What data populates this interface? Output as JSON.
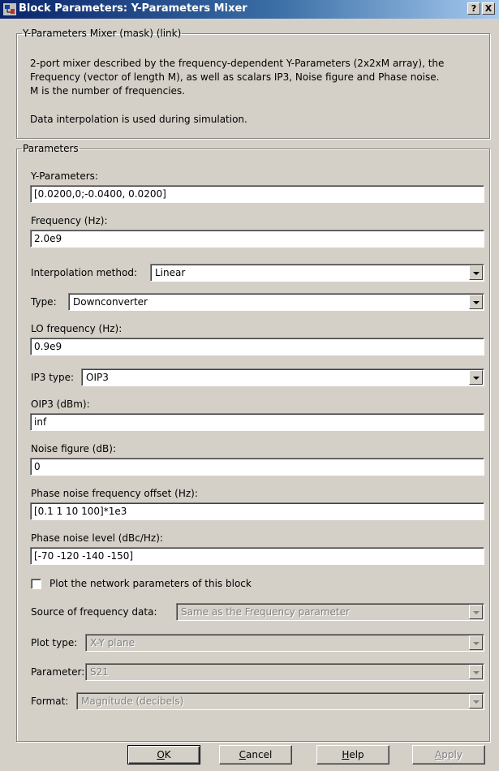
{
  "window": {
    "title": "Block Parameters: Y-Parameters Mixer",
    "help_glyph": "?",
    "close_glyph": "X",
    "icon": "simulink-block-icon"
  },
  "description": {
    "group_title": "Y-Parameters Mixer (mask) (link)",
    "line1": "2-port mixer described by the frequency-dependent Y-Parameters (2x2xM array), the",
    "line2": "Frequency (vector of length M), as well as scalars IP3, Noise figure and Phase noise.",
    "line3": "M is the number of frequencies.",
    "line4": "Data interpolation is used during simulation."
  },
  "parameters": {
    "group_title": "Parameters",
    "y_parameters": {
      "label": "Y-Parameters:",
      "value": "[0.0200,0;-0.0400, 0.0200]"
    },
    "frequency": {
      "label": "Frequency (Hz):",
      "value": "2.0e9"
    },
    "interpolation": {
      "label": "Interpolation method:",
      "value": "Linear"
    },
    "type": {
      "label": "Type:",
      "value": "Downconverter"
    },
    "lo_frequency": {
      "label": "LO frequency (Hz):",
      "value": "0.9e9"
    },
    "ip3_type": {
      "label": "IP3 type:",
      "value": "OIP3"
    },
    "oip3": {
      "label": "OIP3 (dBm):",
      "value": "inf"
    },
    "noise_figure": {
      "label": "Noise figure (dB):",
      "value": "0"
    },
    "phase_noise_offset": {
      "label": "Phase noise frequency offset (Hz):",
      "value": "[0.1 1 10 100]*1e3"
    },
    "phase_noise_level": {
      "label": "Phase noise level (dBc/Hz):",
      "value": "[-70 -120 -140 -150]"
    },
    "plot_checkbox": {
      "label": "Plot the network parameters of this block",
      "checked": false
    },
    "source_freq": {
      "label": "Source of frequency data:",
      "value": "Same as the Frequency parameter"
    },
    "plot_type": {
      "label": "Plot type:",
      "value": "X-Y plane"
    },
    "parameter": {
      "label": "Parameter:",
      "value": "S21"
    },
    "format": {
      "label": "Format:",
      "value": "Magnitude (decibels)"
    }
  },
  "buttons": {
    "ok": {
      "mnemonic": "O",
      "rest": "K"
    },
    "cancel": {
      "mnemonic": "C",
      "rest": "ancel"
    },
    "help": {
      "mnemonic": "H",
      "rest": "elp"
    },
    "apply": {
      "mnemonic": "A",
      "rest": "pply"
    }
  }
}
